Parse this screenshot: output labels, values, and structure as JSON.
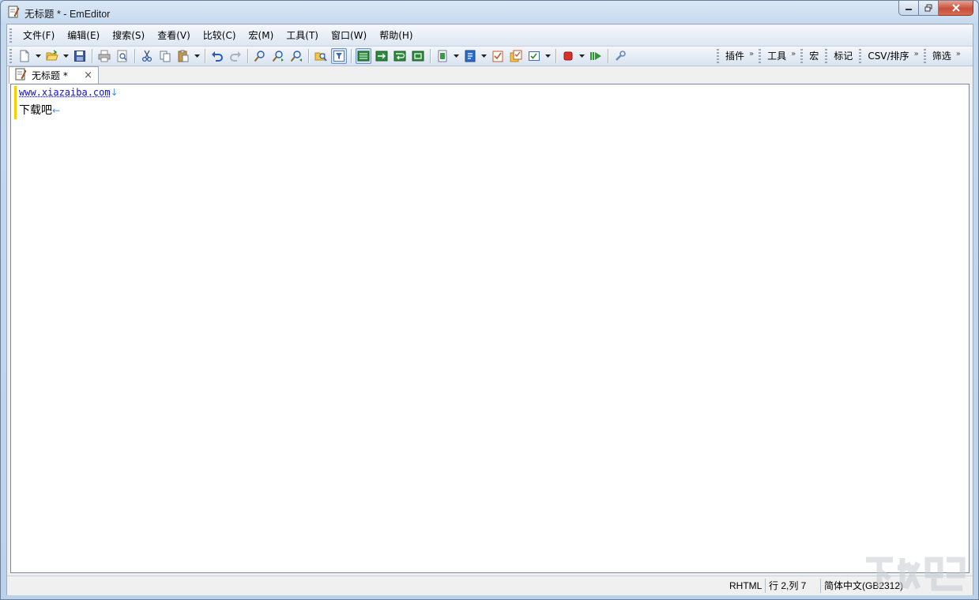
{
  "window": {
    "title": "无标题 * - EmEditor"
  },
  "menubar": {
    "items": [
      "文件(F)",
      "编辑(E)",
      "搜索(S)",
      "查看(V)",
      "比较(C)",
      "宏(M)",
      "工具(T)",
      "窗口(W)",
      "帮助(H)"
    ]
  },
  "toolbar": {
    "groups": [
      "插件",
      "工具",
      "宏",
      "标记",
      "CSV/排序",
      "筛选"
    ],
    "chevron": "»"
  },
  "tabs": [
    {
      "label": "无标题 *",
      "close": "×"
    }
  ],
  "editor": {
    "lines": [
      {
        "text": "www.xiazaiba.com",
        "eol": "↓"
      },
      {
        "text": "下载吧",
        "eol": "←"
      }
    ]
  },
  "status": {
    "mode": "RHTML",
    "position": "行 2,列 7",
    "encoding": "简体中文(GB2312)"
  },
  "colors": {
    "accent": "#3c6db5",
    "change_marker": "#f5d000",
    "url_text": "#1010d0",
    "eol_mark": "#4a8fe0"
  }
}
